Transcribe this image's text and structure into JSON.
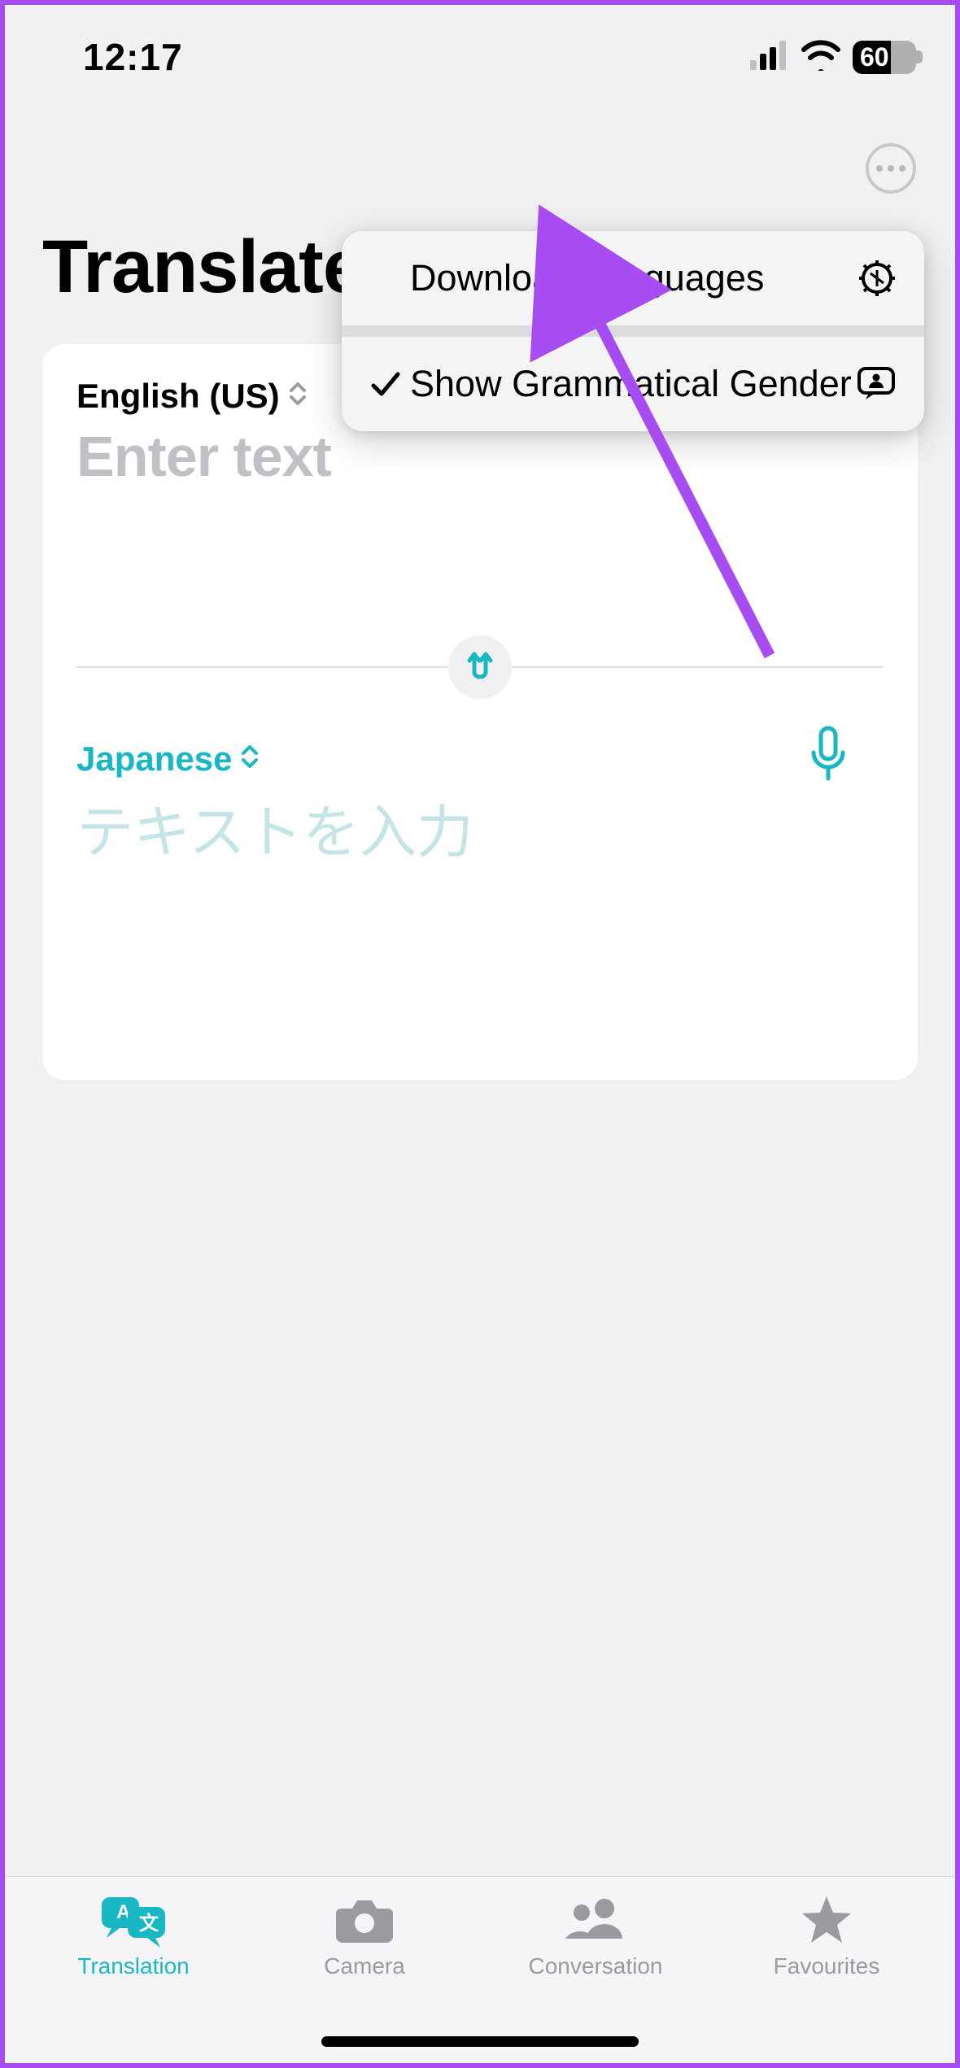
{
  "status": {
    "time": "12:17",
    "battery_percent": "60"
  },
  "page_title": "Translate",
  "card": {
    "source_lang": "English (US)",
    "source_placeholder": "Enter text",
    "target_lang": "Japanese",
    "target_placeholder": "テキストを入力"
  },
  "menu": {
    "download_languages": "Download Languages",
    "show_grammatical_gender": "Show Grammatical Gender"
  },
  "tabs": {
    "translation": "Translation",
    "camera": "Camera",
    "conversation": "Conversation",
    "favourites": "Favourites"
  }
}
